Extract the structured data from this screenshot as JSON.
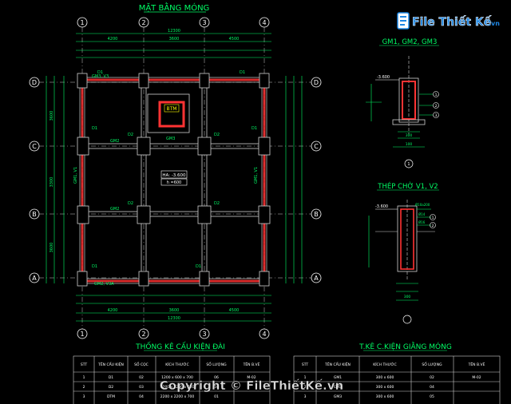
{
  "drawing": {
    "title": "MẶT BẰNG MÓNG",
    "grid_numbers": [
      "1",
      "2",
      "3",
      "4"
    ],
    "grid_letters": [
      "D",
      "C",
      "B",
      "A"
    ],
    "overall_dim": "12300",
    "span_dims": [
      "4200",
      "3600",
      "4500"
    ],
    "bay_dims": [
      "3600",
      "3300",
      "3600"
    ],
    "pit_label": "BTM",
    "level_tag": "HA: -3.600",
    "level_sub": "h =600",
    "beam_labels": [
      "GM3, V3",
      "GM2",
      "GM1, V1",
      "GM1, V1",
      "GM3",
      "GM2, V3A",
      "GM2"
    ],
    "footing_labels": [
      "D1",
      "D1",
      "D2",
      "D2",
      "D1",
      "D1",
      "D2",
      "D2",
      "D1",
      "D1"
    ]
  },
  "section1": {
    "title": "GM1, GM2, GM3",
    "level": "-3.600",
    "callouts": [
      "1",
      "2",
      "3"
    ],
    "cut_mark": "1",
    "width_dim": "300",
    "base_dim": "100"
  },
  "section2": {
    "title": "THÉP CHỜ V1, V2",
    "level": "-3.600",
    "callouts": [
      "1",
      "2"
    ],
    "rebar": [
      "Ø10a200",
      "Ø14",
      "Ø16"
    ],
    "width_dim": "300"
  },
  "table1": {
    "title": "THỐNG KÊ CẤU KIỆN ĐÀI",
    "headers": [
      "STT",
      "TÊN CẤU KIỆN",
      "SỐ CỌC",
      "KÍCH THƯỚC",
      "SỐ LƯỢNG",
      "TÊN B.VẼ"
    ],
    "rows": [
      [
        "1",
        "D1",
        "02",
        "1200 x 600 x 700",
        "06",
        "M-02"
      ],
      [
        "2",
        "D2",
        "03",
        "1200 x 1200 x 700",
        "04",
        ""
      ],
      [
        "3",
        "DTM",
        "04",
        "2200 x 2200 x 700",
        "01",
        ""
      ]
    ]
  },
  "table2": {
    "title": "T.KÊ C.KIỆN GIẰNG MÓNG",
    "headers": [
      "STT",
      "TÊN CẤU KIỆN",
      "KÍCH THƯỚC",
      "SỐ LƯỢNG",
      "TÊN B.VẼ"
    ],
    "rows": [
      [
        "1",
        "GM1",
        "300 x 600",
        "02",
        "M-02"
      ],
      [
        "2",
        "GM2",
        "300 x 600",
        "04",
        ""
      ],
      [
        "3",
        "GM3",
        "300 x 600",
        "05",
        ""
      ]
    ]
  },
  "brand": {
    "logo_text": "File Thiết Kế",
    "logo_suffix": ".vn",
    "copyright": "Copyright © FileThiếtKế.vn"
  },
  "colors": {
    "background": "#000000",
    "grid": "#ffffff",
    "dimension": "#00ff66",
    "beam": "#ff3333",
    "footing": "#cccccc",
    "label_yellow": "#ffff00",
    "logo_blue": "#1e88e5"
  }
}
